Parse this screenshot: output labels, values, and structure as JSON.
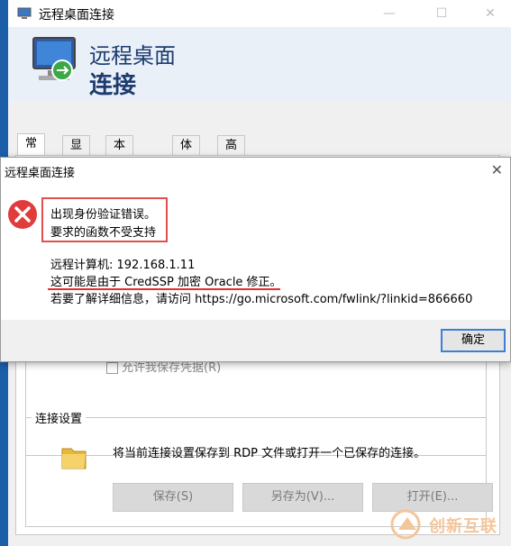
{
  "back_window": {
    "title": "远程桌面连接",
    "header_line1": "远程桌面",
    "header_line2": "连接",
    "tabs": [
      "常规",
      "显示",
      "本地资源",
      "体验",
      "高级"
    ],
    "save_credentials_label": "允许我保存凭据(R)",
    "connection_settings_title": "连接设置",
    "connection_settings_text": "将当前连接设置保存到 RDP 文件或打开一个已保存的连接。",
    "buttons": {
      "save": "保存(S)",
      "save_as": "另存为(V)...",
      "open": "打开(E)..."
    }
  },
  "dialog": {
    "title": "远程桌面连接",
    "close": "✕",
    "error_line1": "出现身份验证错误。",
    "error_line2": "要求的函数不受支持",
    "remote_computer": "远程计算机: 192.168.1.11",
    "cause": "这可能是由于 CredSSP 加密 Oracle 修正。",
    "more_info": "若要了解详细信息，请访问 https://go.microsoft.com/fwlink/?linkid=866660",
    "ok_label": "确定"
  },
  "watermark": {
    "text": "创新互联"
  },
  "colors": {
    "highlight_box": "#e05050",
    "underline": "#e03030",
    "error_red": "#e23b3b",
    "header_blue": "#1d3b70"
  }
}
